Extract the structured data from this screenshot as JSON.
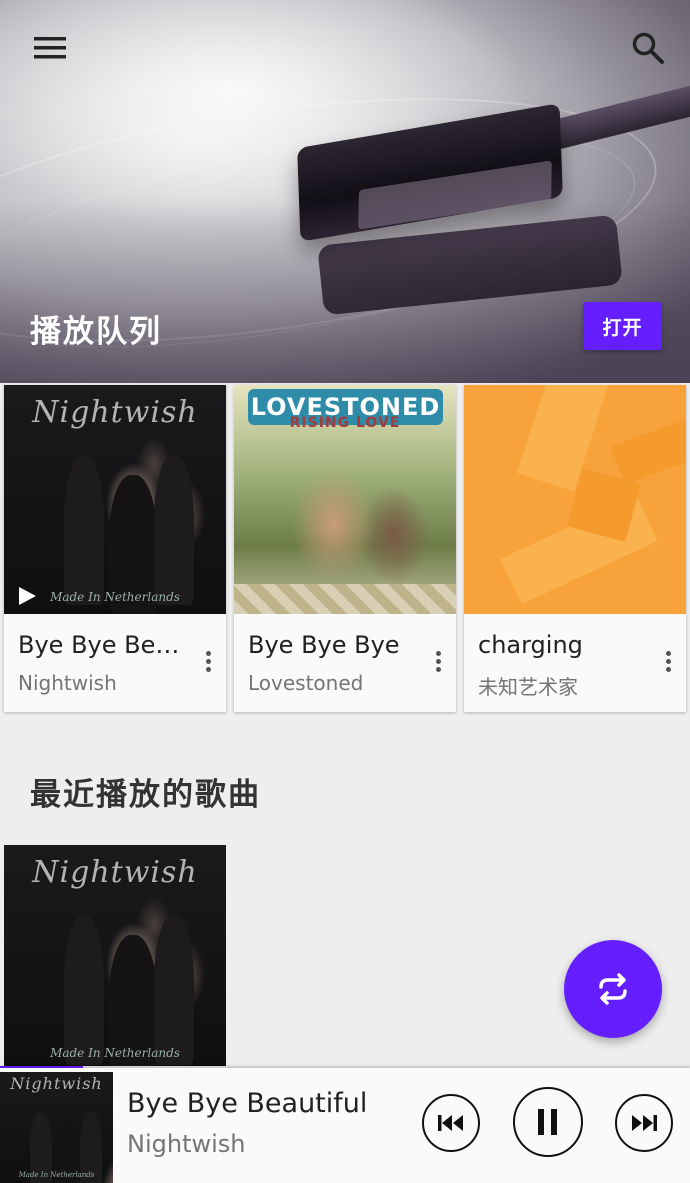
{
  "header": {
    "menu_icon": "menu-icon",
    "search_icon": "search-icon"
  },
  "queue": {
    "title": "播放队列",
    "open_label": "打开",
    "items": [
      {
        "title": "Bye Bye Be…",
        "artist": "Nightwish",
        "art_logo": "Nightwish",
        "art_caption": "Made In Netherlands",
        "playing": true
      },
      {
        "title": "Bye Bye Bye",
        "artist": "Lovestoned",
        "art_logo": "LOVESTONED",
        "art_caption": "RISING LOVE",
        "playing": false
      },
      {
        "title": "charging",
        "artist": "未知艺术家",
        "playing": false
      }
    ]
  },
  "recent": {
    "title": "最近播放的歌曲",
    "items": [
      {
        "art_logo": "Nightwish",
        "art_caption": "Made In Netherlands"
      }
    ]
  },
  "fab": {
    "icon": "repeat-icon"
  },
  "now_playing": {
    "title": "Bye Bye Beautiful",
    "artist": "Nightwish",
    "art_logo": "Nightwish",
    "art_caption": "Made In Netherlands",
    "progress": 0.12,
    "prev_icon": "skip-previous-icon",
    "pause_icon": "pause-icon",
    "next_icon": "skip-next-icon"
  },
  "colors": {
    "accent": "#651fff",
    "background": "#eeeeee",
    "card": "#fafafa"
  }
}
